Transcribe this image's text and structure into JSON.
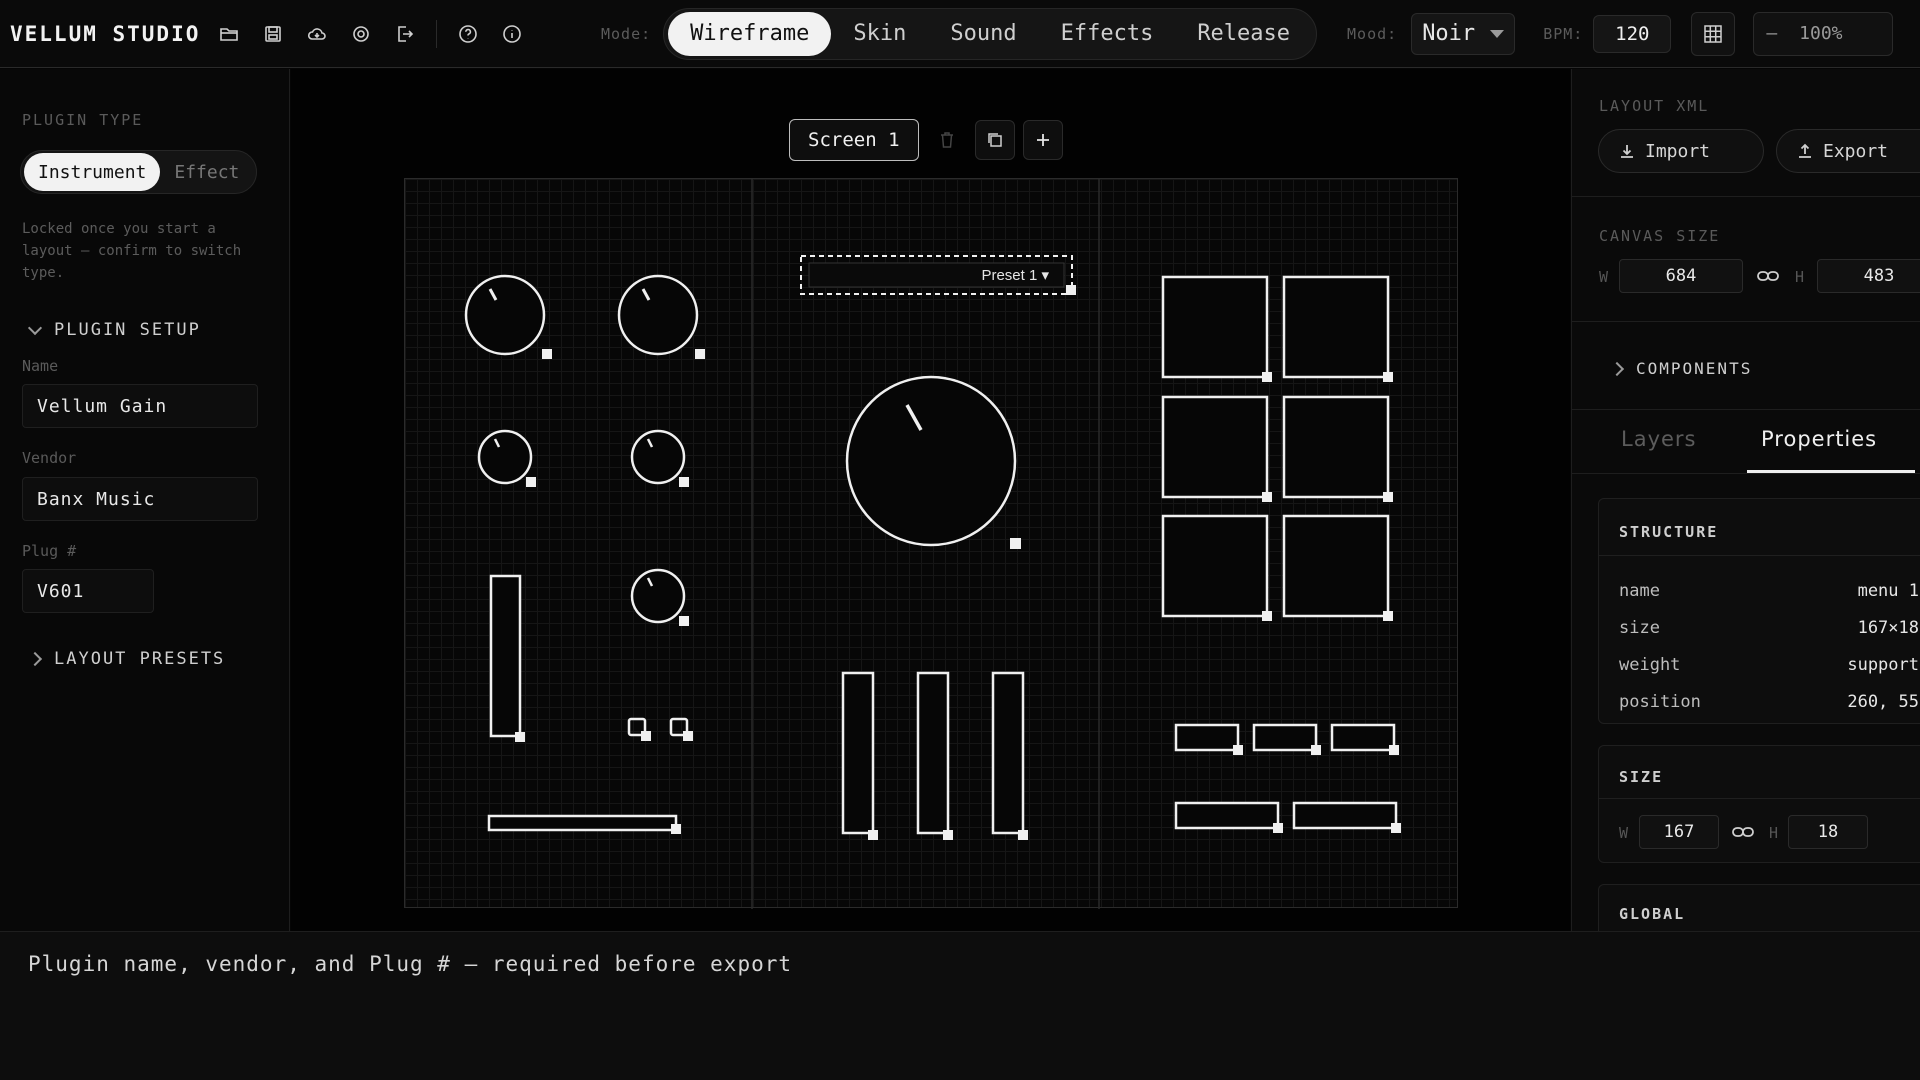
{
  "app": {
    "title": "VELLUM STUDIO"
  },
  "toolbar": {
    "icons": [
      "folder-open-icon",
      "save-icon",
      "cloud-icon",
      "settings-icon",
      "exit-icon",
      "help-icon",
      "info-icon"
    ],
    "mode_label": "Mode:",
    "modes": [
      "Wireframe",
      "Skin",
      "Sound",
      "Effects",
      "Release"
    ],
    "active_mode": "Wireframe",
    "mood_label": "Mood:",
    "mood_value": "Noir",
    "bpm_label": "BPM:",
    "bpm_value": "120",
    "zoom_minus": "–",
    "zoom_value": "100%"
  },
  "left": {
    "plugin_type_label": "PLUGIN TYPE",
    "types": [
      "Instrument",
      "Effect"
    ],
    "active_type": "Instrument",
    "hint": "Locked once you start a layout — confirm to switch type.",
    "setup_label": "PLUGIN SETUP",
    "name_label": "Name",
    "name_value": "Vellum Gain",
    "vendor_label": "Vendor",
    "vendor_value": "Banx Music",
    "plug_label": "Plug #",
    "plug_value": "V601",
    "presets_label": "LAYOUT PRESETS"
  },
  "workspace": {
    "screen_tab": "Screen 1",
    "preset_label": "Preset 1 ▾"
  },
  "right": {
    "layout_xml_label": "LAYOUT XML",
    "import_label": "Import",
    "export_label": "Export",
    "canvas_size_label": "CANVAS SIZE",
    "canvas_w_label": "W",
    "canvas_w": "684",
    "canvas_h_label": "H",
    "canvas_h": "483",
    "components_label": "COMPONENTS",
    "tabs": [
      "Layers",
      "Properties"
    ],
    "active_tab": "Properties",
    "structure_title": "STRUCTURE",
    "properties": [
      {
        "key": "name",
        "value": "menu 1"
      },
      {
        "key": "size",
        "value": "167×18"
      },
      {
        "key": "weight",
        "value": "support"
      },
      {
        "key": "position",
        "value": "260, 55"
      }
    ],
    "size_title": "SIZE",
    "size_w_label": "W",
    "size_w": "167",
    "size_h_label": "H",
    "size_h": "18",
    "global_title": "GLOBAL"
  },
  "status": {
    "text": "Plugin name, vendor, and Plug # — required before export"
  },
  "colors": {
    "background": "#050505",
    "accent": "#f2f2f2",
    "panel": "#0a0a0a"
  }
}
